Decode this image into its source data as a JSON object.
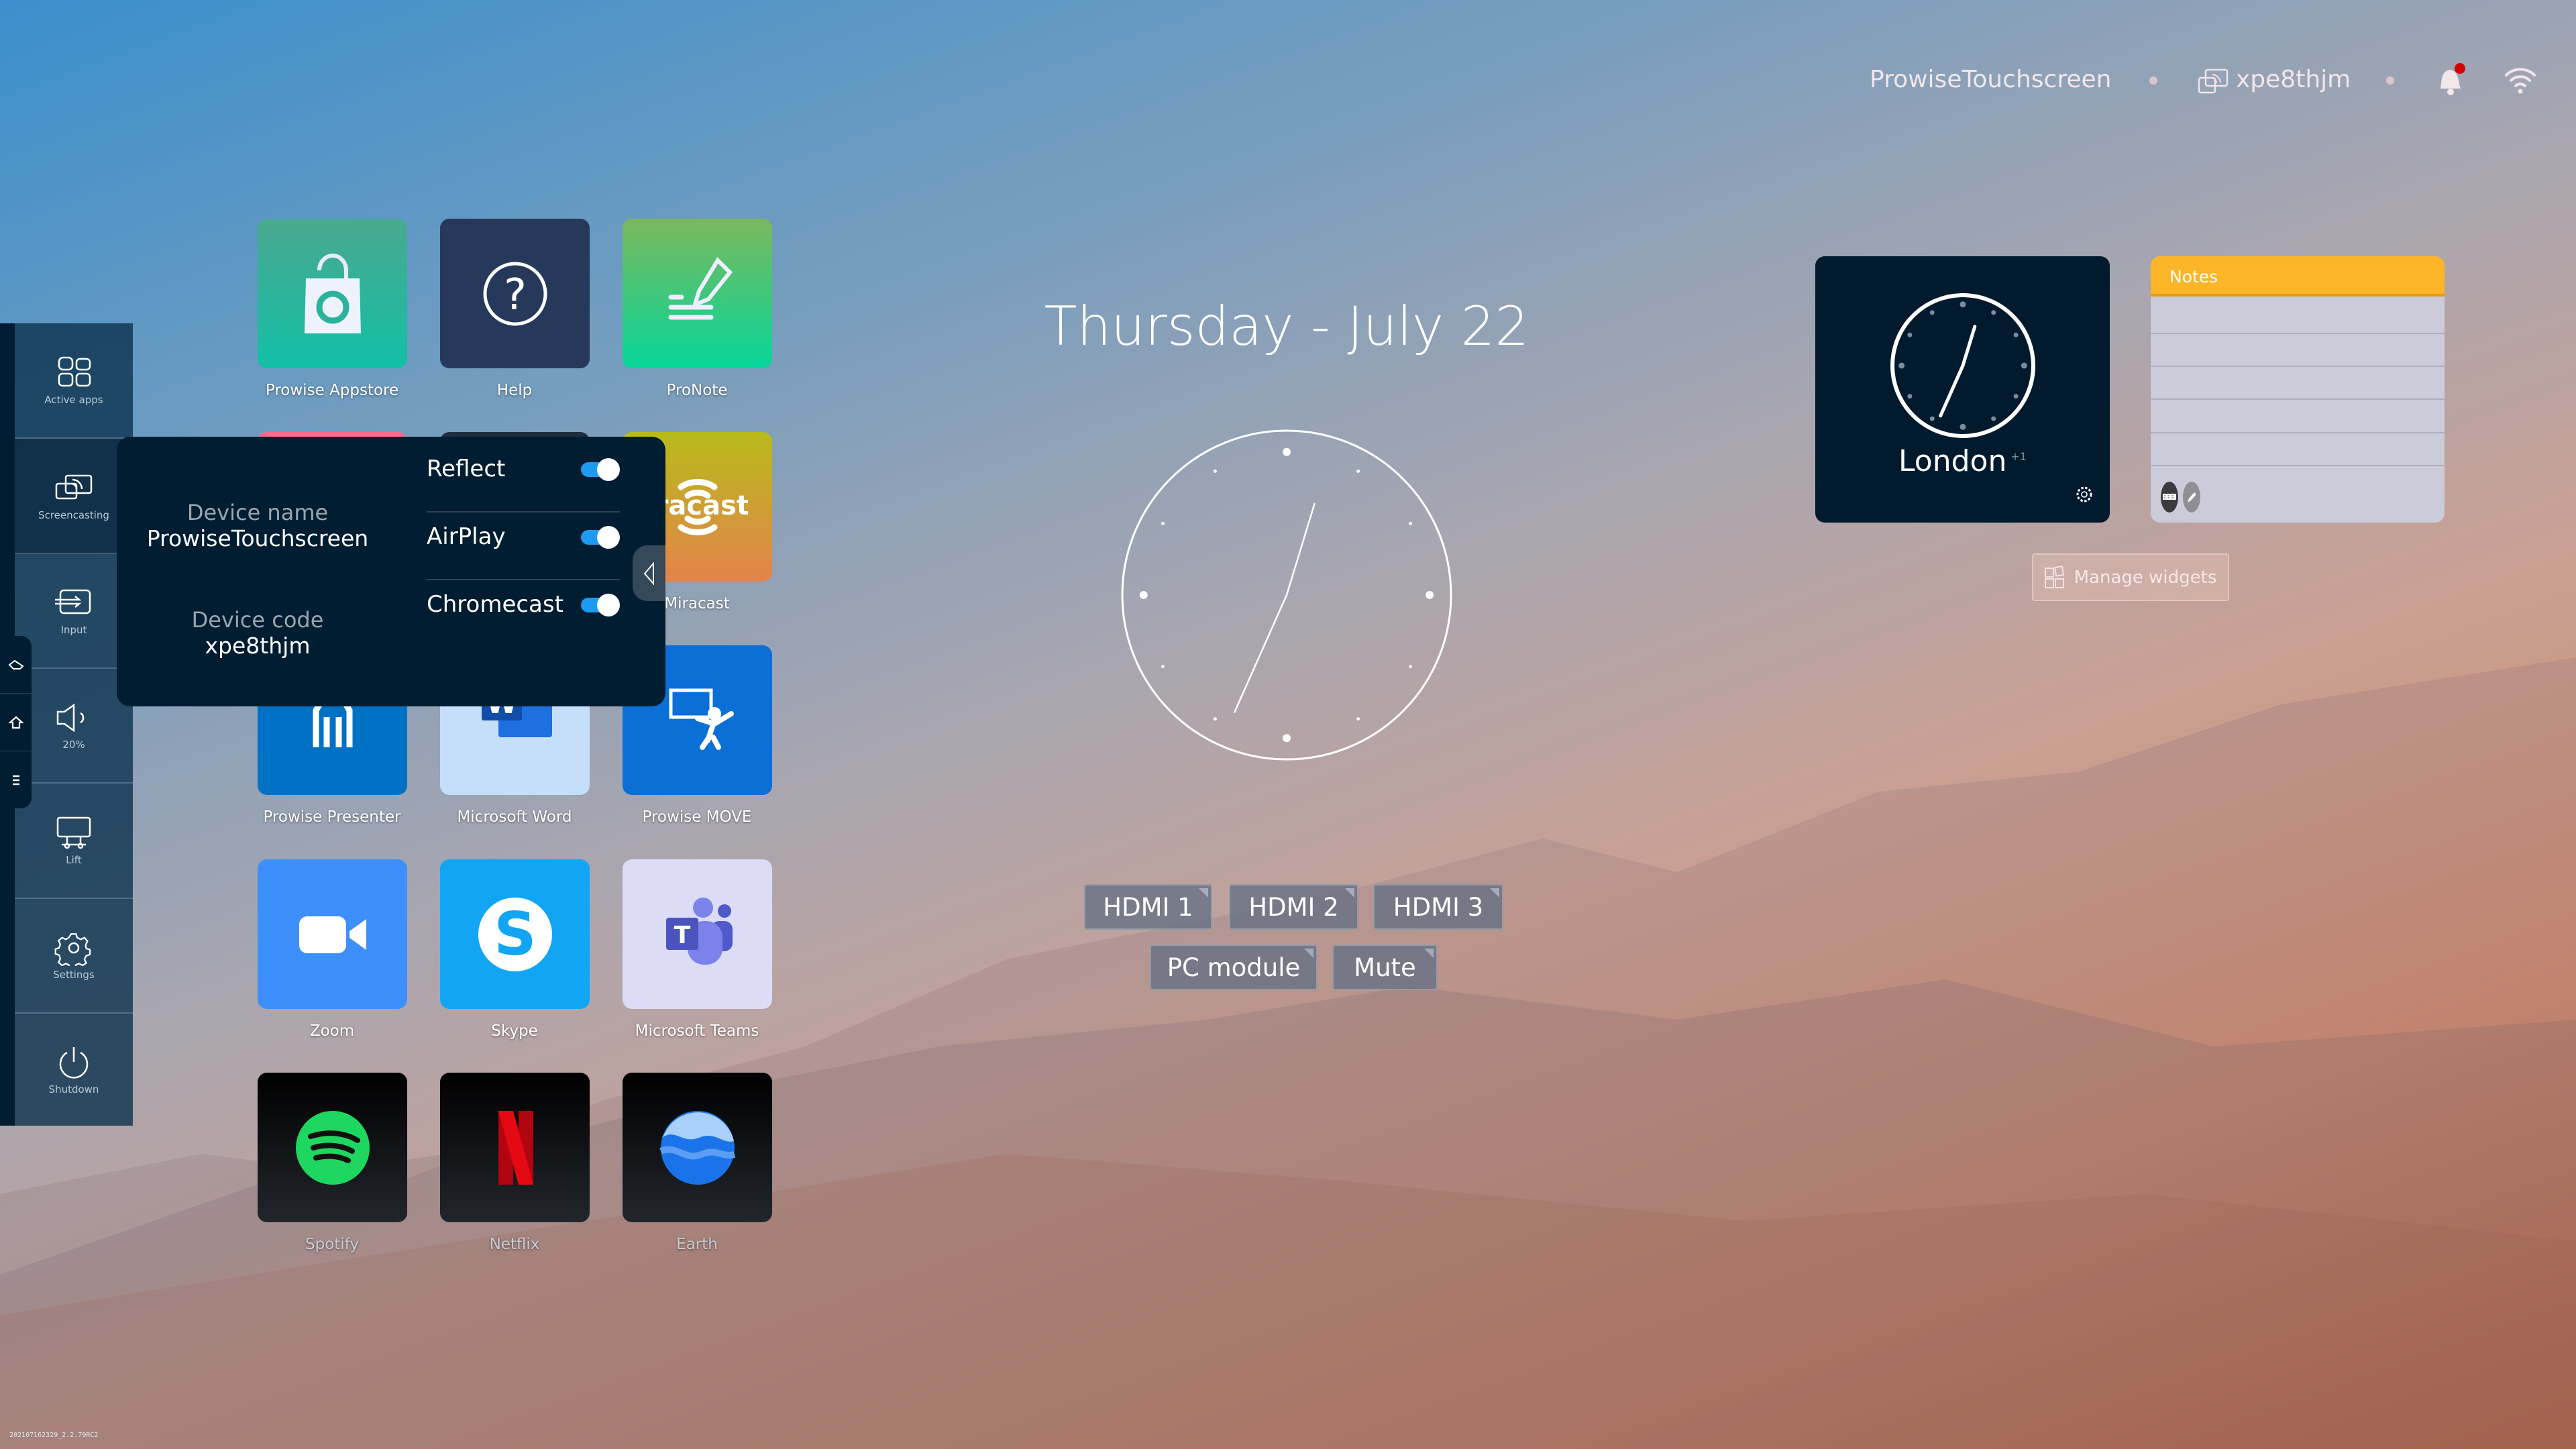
{
  "header": {
    "device_name": "ProwiseTouchscreen",
    "device_code": "xpe8thjm",
    "icons": [
      "screencast-icon",
      "bell-icon",
      "wifi-icon"
    ],
    "notification_badge_color": "#d40000"
  },
  "sidebar": {
    "items": [
      {
        "label": "Active apps",
        "icon": "grid-icon"
      },
      {
        "label": "Screencasting",
        "icon": "screencast-icon",
        "active": true
      },
      {
        "label": "Input",
        "icon": "input-icon"
      },
      {
        "label": "20%",
        "icon": "volume-icon"
      },
      {
        "label": "Lift",
        "icon": "lift-icon"
      },
      {
        "label": "Settings",
        "icon": "gear-icon"
      },
      {
        "label": "Shutdown",
        "icon": "power-icon"
      }
    ],
    "quick_buttons": [
      "pencil-icon",
      "home-icon",
      "menu-icon"
    ]
  },
  "apps": [
    {
      "label": "Prowise Appstore",
      "icon": "shopping-bag-icon",
      "color": "#2bb39b"
    },
    {
      "label": "Help",
      "icon": "question-icon",
      "color": "#27395a"
    },
    {
      "label": "ProNote",
      "icon": "pronote-icon",
      "color": "#34cc7e"
    },
    {
      "label": "",
      "icon": "hidden-app-icon",
      "color": "#ff6b8a"
    },
    {
      "label": "",
      "icon": "hidden-app-icon",
      "color": "#1f2d40"
    },
    {
      "label": "Miracast",
      "icon": "miracast-icon",
      "color": "#d79a35"
    },
    {
      "label": "Prowise Presenter",
      "icon": "presenter-icon",
      "color": "#0072c6"
    },
    {
      "label": "Microsoft Word",
      "icon": "word-icon",
      "color": "#c5dffb"
    },
    {
      "label": "Prowise MOVE",
      "icon": "move-icon",
      "color": "#0a6fd6"
    },
    {
      "label": "Zoom",
      "icon": "zoom-camera-icon",
      "color": "#3d8ffb"
    },
    {
      "label": "Skype",
      "icon": "skype-icon",
      "color": "#12a5f4"
    },
    {
      "label": "Microsoft Teams",
      "icon": "teams-icon",
      "color": "#dcdcf7"
    },
    {
      "label": "Spotify",
      "icon": "spotify-icon",
      "color": "#111418"
    },
    {
      "label": "Netflix",
      "icon": "netflix-icon",
      "color": "#111418"
    },
    {
      "label": "Earth",
      "icon": "earth-icon",
      "color": "#111418"
    }
  ],
  "popup": {
    "device_name_label": "Device name",
    "device_name": "ProwiseTouchscreen",
    "device_code_label": "Device code",
    "device_code": "xpe8thjm",
    "toggles": [
      {
        "label": "Reflect",
        "on": true
      },
      {
        "label": "AirPlay",
        "on": true
      },
      {
        "label": "Chromecast",
        "on": true
      }
    ],
    "accent": "#1d9bf0"
  },
  "main": {
    "date": "Thursday - July 22",
    "clock_time": "12:34",
    "sources": [
      "HDMI 1",
      "HDMI 2",
      "HDMI 3",
      "PC module",
      "Mute"
    ]
  },
  "widgets": {
    "clock": {
      "city": "London",
      "offset": "+1",
      "time": "12:34"
    },
    "notes": {
      "title": "Notes",
      "header_color": "#fbb526"
    },
    "manage_label": "Manage widgets"
  },
  "version": "202107162329_2.2.79RC2"
}
